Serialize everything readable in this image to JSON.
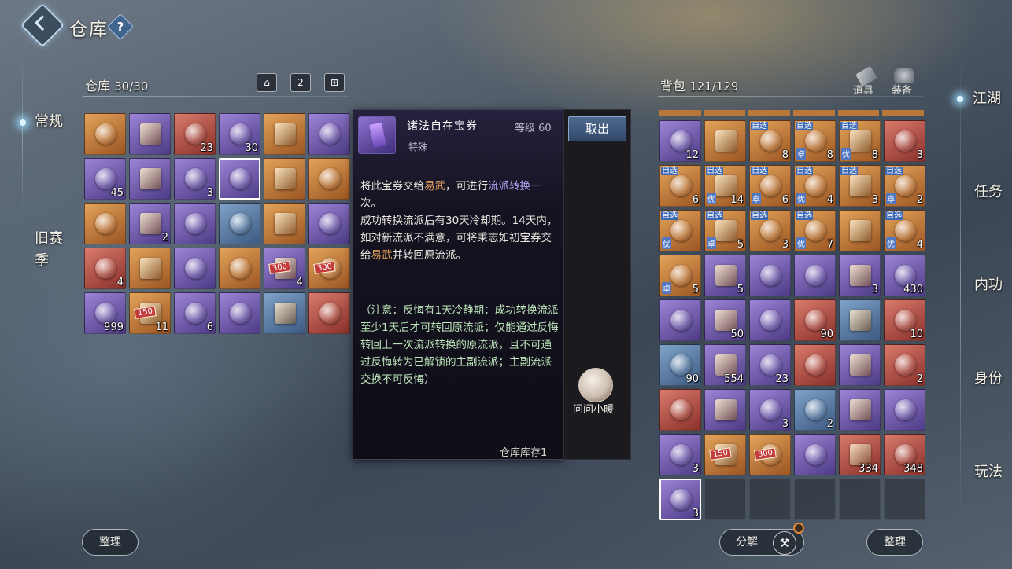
{
  "header": {
    "title": "仓库",
    "help": "?"
  },
  "left_nav": {
    "items": [
      {
        "label": "常规",
        "active": true
      },
      {
        "label": "旧赛季",
        "active": false
      }
    ]
  },
  "right_nav": {
    "items": [
      {
        "label": "江湖",
        "active": true
      },
      {
        "label": "任务"
      },
      {
        "label": "内功"
      },
      {
        "label": "身份"
      },
      {
        "label": "玩法"
      }
    ]
  },
  "warehouse": {
    "label": "仓库",
    "count": "30/30",
    "tool_icons": [
      "chest-icon",
      "2",
      "grid-icon"
    ],
    "slots": [
      {
        "r": "orange",
        "c": ""
      },
      {
        "r": "purple",
        "c": ""
      },
      {
        "r": "red",
        "c": "23"
      },
      {
        "r": "purple",
        "c": "30"
      },
      {
        "r": "orange",
        "c": ""
      },
      {
        "r": "purple",
        "c": ""
      },
      {
        "r": "purple",
        "c": "45"
      },
      {
        "r": "purple",
        "c": ""
      },
      {
        "r": "purple",
        "c": "3"
      },
      {
        "r": "purple",
        "c": "",
        "sel": true
      },
      {
        "r": "orange",
        "c": ""
      },
      {
        "r": "orange",
        "c": ""
      },
      {
        "r": "orange",
        "c": ""
      },
      {
        "r": "purple",
        "c": "2"
      },
      {
        "r": "purple",
        "c": ""
      },
      {
        "r": "blue",
        "c": ""
      },
      {
        "r": "orange",
        "c": ""
      },
      {
        "r": "purple",
        "c": ""
      },
      {
        "r": "red",
        "c": "4"
      },
      {
        "r": "orange",
        "c": ""
      },
      {
        "r": "purple",
        "c": ""
      },
      {
        "r": "orange",
        "c": ""
      },
      {
        "r": "purple",
        "c": "4",
        "tag": "300"
      },
      {
        "r": "orange",
        "c": "",
        "tag": "300"
      },
      {
        "r": "purple",
        "c": "999"
      },
      {
        "r": "orange",
        "c": "11",
        "tag": "150"
      },
      {
        "r": "purple",
        "c": "6"
      },
      {
        "r": "purple",
        "c": ""
      },
      {
        "r": "blue",
        "c": ""
      },
      {
        "r": "red",
        "c": ""
      }
    ],
    "sort_button": "整理"
  },
  "tooltip": {
    "name": "诸法自在宝券",
    "level": "等级 60",
    "type": "特殊",
    "line1a": "将此宝券交给",
    "line1b": "易武",
    "line1c": "，可进行",
    "line1d": "流派转换",
    "line1e": "一次。",
    "line2a": "成功转换流派后有30天冷却期。14天内，如对新流派不满意，可将秉志如初宝券交给",
    "line2b": "易武",
    "line2c": "并转回原流派。",
    "note": "（注意：反悔有1天冷静期：成功转换流派至少1天后才可转回原流派；仅能通过反悔转回上一次流派转换的原流派，且不可通过反悔转为已解锁的主副流派；主副流派交换不可反悔）",
    "stock": "仓库库存1",
    "take_out": "取出",
    "ask": "问问小暖"
  },
  "backpack": {
    "label": "背包",
    "count": "121/129",
    "tabs": [
      {
        "label": "道具"
      },
      {
        "label": "装备"
      }
    ],
    "slots": [
      {
        "r": "purple",
        "c": "12"
      },
      {
        "r": "orange",
        "c": ""
      },
      {
        "r": "orange",
        "c": "8",
        "b": "自选"
      },
      {
        "r": "orange",
        "c": "8",
        "b": "自选",
        "b2": "卓"
      },
      {
        "r": "orange",
        "c": "8",
        "b": "自选",
        "b2": "优"
      },
      {
        "r": "red",
        "c": "3"
      },
      {
        "r": "orange",
        "c": "6",
        "b": "自选"
      },
      {
        "r": "orange",
        "c": "14",
        "b": "自选",
        "b2": "优"
      },
      {
        "r": "orange",
        "c": "6",
        "b": "自选",
        "b2": "卓"
      },
      {
        "r": "orange",
        "c": "4",
        "b": "自选",
        "b2": "优"
      },
      {
        "r": "orange",
        "c": "3",
        "b": "自选"
      },
      {
        "r": "orange",
        "c": "2",
        "b": "自选",
        "b2": "卓"
      },
      {
        "r": "orange",
        "c": "",
        "b": "自选",
        "b2": "优"
      },
      {
        "r": "orange",
        "c": "5",
        "b": "自选",
        "b2": "卓"
      },
      {
        "r": "orange",
        "c": "3",
        "b": "自选"
      },
      {
        "r": "orange",
        "c": "7",
        "b": "自选",
        "b2": "优"
      },
      {
        "r": "orange",
        "c": ""
      },
      {
        "r": "orange",
        "c": "4",
        "b": "自选",
        "b2": "优"
      },
      {
        "r": "orange",
        "c": "5",
        "b2": "卓"
      },
      {
        "r": "purple",
        "c": "5"
      },
      {
        "r": "purple",
        "c": ""
      },
      {
        "r": "purple",
        "c": ""
      },
      {
        "r": "purple",
        "c": "3"
      },
      {
        "r": "purple",
        "c": "430"
      },
      {
        "r": "purple",
        "c": ""
      },
      {
        "r": "purple",
        "c": "50"
      },
      {
        "r": "purple",
        "c": ""
      },
      {
        "r": "red",
        "c": "90"
      },
      {
        "r": "blue",
        "c": ""
      },
      {
        "r": "red",
        "c": "10"
      },
      {
        "r": "blue",
        "c": "90"
      },
      {
        "r": "purple",
        "c": "554"
      },
      {
        "r": "purple",
        "c": "23"
      },
      {
        "r": "red",
        "c": ""
      },
      {
        "r": "purple",
        "c": ""
      },
      {
        "r": "red",
        "c": "2"
      },
      {
        "r": "red",
        "c": ""
      },
      {
        "r": "purple",
        "c": ""
      },
      {
        "r": "purple",
        "c": "3"
      },
      {
        "r": "blue",
        "c": "2"
      },
      {
        "r": "purple",
        "c": ""
      },
      {
        "r": "purple",
        "c": ""
      },
      {
        "r": "purple",
        "c": "3"
      },
      {
        "r": "orange",
        "c": "",
        "tag": "150"
      },
      {
        "r": "orange",
        "c": "",
        "tag": "300"
      },
      {
        "r": "purple",
        "c": ""
      },
      {
        "r": "red",
        "c": "334"
      },
      {
        "r": "red",
        "c": "348"
      },
      {
        "r": "purple",
        "c": "3",
        "sel": true
      },
      {
        "r": "empty",
        "c": ""
      },
      {
        "r": "empty",
        "c": ""
      },
      {
        "r": "empty",
        "c": ""
      },
      {
        "r": "empty",
        "c": ""
      },
      {
        "r": "empty",
        "c": ""
      }
    ],
    "decompose_button": "分解",
    "sort_button": "整理"
  }
}
